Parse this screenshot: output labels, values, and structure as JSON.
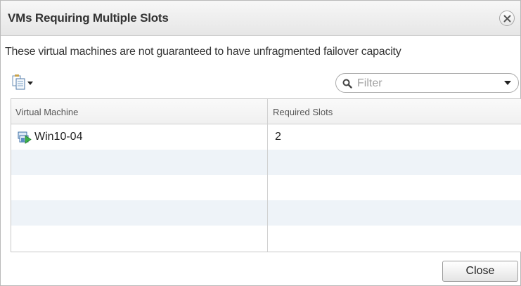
{
  "dialog": {
    "title": "VMs Requiring Multiple Slots",
    "description": "These virtual machines are not guaranteed to have unfragmented failover capacity",
    "close_button_label": "Close"
  },
  "toolbar": {
    "export_icon": "export-list-icon",
    "filter_placeholder": "Filter"
  },
  "table": {
    "columns": [
      "Virtual Machine",
      "Required Slots"
    ],
    "rows": [
      {
        "vm": "Win10-04",
        "slots": "2",
        "icon": "vm-powered-on-icon"
      }
    ]
  }
}
